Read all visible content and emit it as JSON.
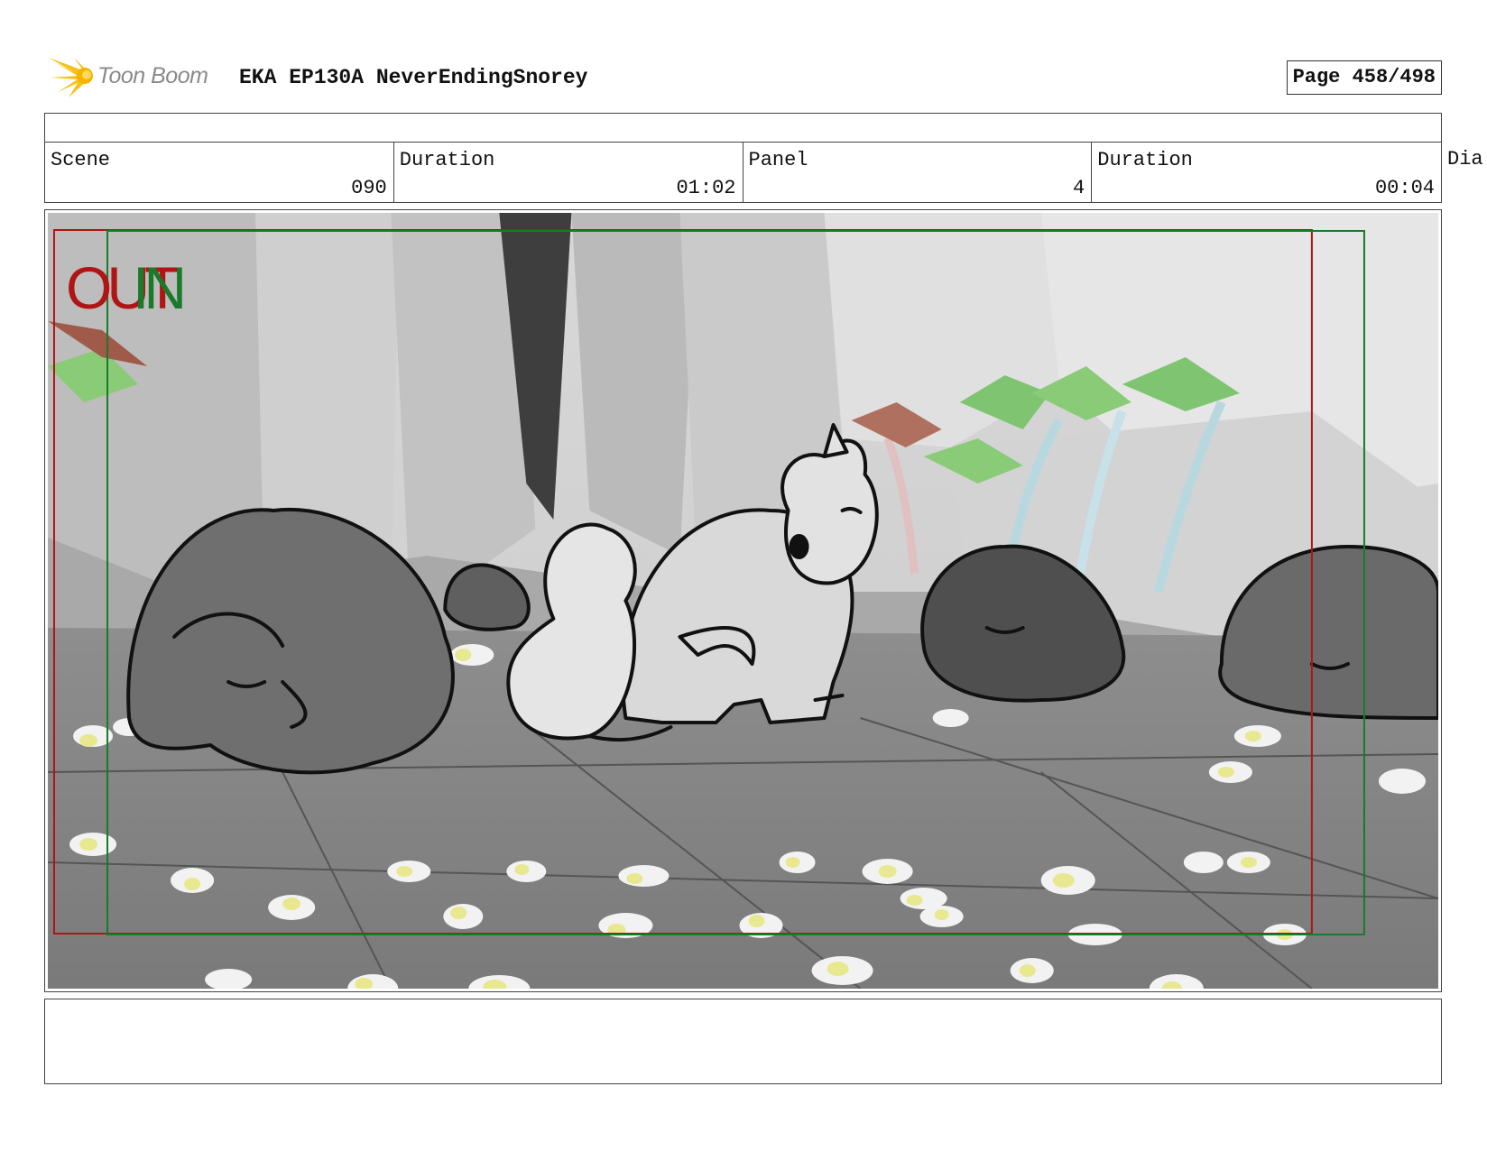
{
  "header": {
    "brand": "Toon Boom",
    "project_title": "EKA EP130A NeverEndingSnorey",
    "page_label": "Page 458/498"
  },
  "info": {
    "scene_label": "Scene",
    "scene_value": "090",
    "scene_duration_label": "Duration",
    "scene_duration_value": "01:02",
    "panel_label": "Panel",
    "panel_value": "4",
    "panel_duration_label": "Duration",
    "panel_duration_value": "00:04",
    "overflow_label": "Dia"
  },
  "panel": {
    "out_text": "OUT",
    "in_text": "IN"
  },
  "colors": {
    "out_frame": "#b01515",
    "in_frame": "#1a7a2a",
    "border": "#444444"
  }
}
